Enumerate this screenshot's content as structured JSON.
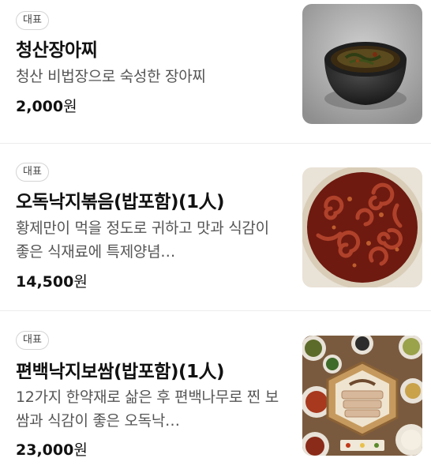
{
  "menu": {
    "items": [
      {
        "badge": "대표",
        "name": "청산장아찌",
        "description": "청산 비법장으로 숙성한 장아찌",
        "price": "2,000",
        "price_unit": "원",
        "image_alt": "청산장아찌"
      },
      {
        "badge": "대표",
        "name": "오독낙지볶음(밥포함)(1人)",
        "description": "황제만이 먹을 정도로 귀하고 맛과 식감이 좋은 식재료에 특제양념…",
        "price": "14,500",
        "price_unit": "원",
        "image_alt": "오독낙지볶음(밥포함)(1人)"
      },
      {
        "badge": "대표",
        "name": "편백낙지보쌈(밥포함)(1人)",
        "description": "12가지 한약재로 삶은 후 편백나무로 찐 보쌈과 식감이 좋은 오독낙…",
        "price": "23,000",
        "price_unit": "원",
        "image_alt": "편백낙지보쌈(밥포함)(1人)"
      }
    ]
  }
}
